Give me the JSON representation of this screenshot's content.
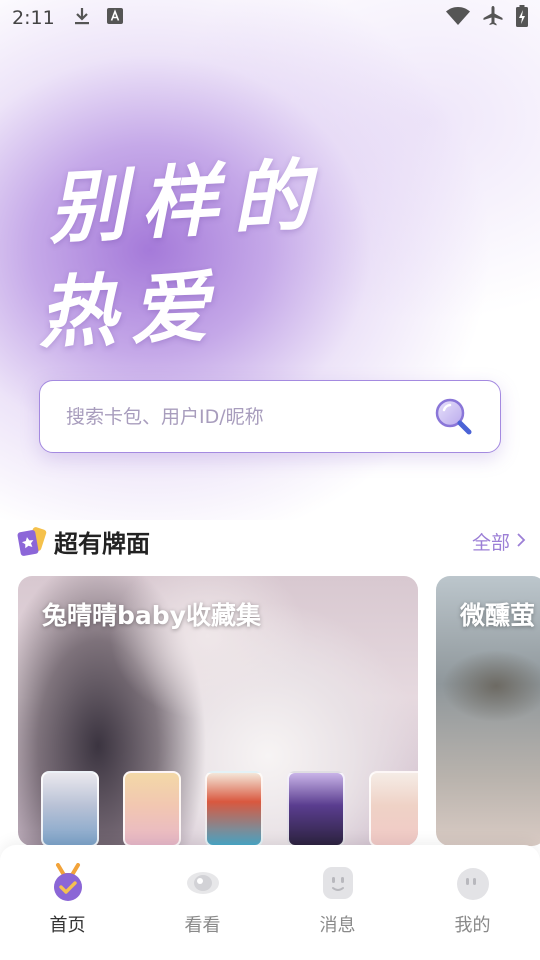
{
  "status_bar": {
    "time": "2:11",
    "left_icons": [
      "download-icon",
      "a-badge-icon"
    ],
    "right_icons": [
      "wifi-icon",
      "airplane-icon",
      "battery-icon"
    ]
  },
  "hero": {
    "line1": "别样的",
    "line2": "热爱"
  },
  "search": {
    "placeholder": "搜索卡包、用户ID/昵称"
  },
  "section": {
    "title": "超有牌面",
    "more_label": "全部"
  },
  "cards": [
    {
      "title": "兔晴晴baby收藏集",
      "thumb_count": 5
    },
    {
      "title": "微醺萤"
    }
  ],
  "nav": {
    "items": [
      {
        "label": "首页",
        "icon": "home-medal-icon",
        "active": true
      },
      {
        "label": "看看",
        "icon": "eye-icon",
        "active": false
      },
      {
        "label": "消息",
        "icon": "message-face-icon",
        "active": false
      },
      {
        "label": "我的",
        "icon": "profile-face-icon",
        "active": false
      }
    ]
  },
  "colors": {
    "accent": "#9c7fd6",
    "search_border": "#a48ae0",
    "hero_purple": "#a073d7"
  }
}
